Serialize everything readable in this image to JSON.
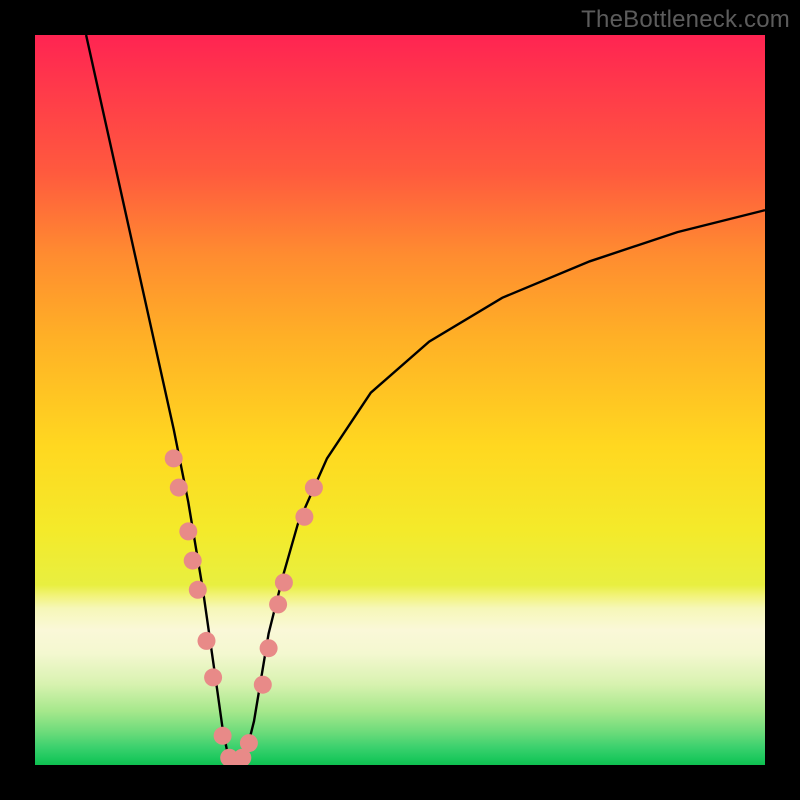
{
  "watermark": "TheBottleneck.com",
  "chart_data": {
    "type": "line",
    "title": "",
    "xlabel": "",
    "ylabel": "",
    "xlim": [
      0,
      100
    ],
    "ylim": [
      0,
      100
    ],
    "background": {
      "description": "vertical gradient red-to-green indicating bottleneck severity",
      "stops": [
        {
          "pos": 0,
          "color": "#ff2452"
        },
        {
          "pos": 55,
          "color": "#ffd820"
        },
        {
          "pos": 80,
          "color": "#f6f7b8"
        },
        {
          "pos": 100,
          "color": "#0ec050"
        }
      ]
    },
    "series": [
      {
        "name": "bottleneck-curve",
        "color": "#000000",
        "x": [
          7,
          9,
          11,
          13,
          15,
          17,
          19,
          21,
          22,
          23,
          24,
          25,
          25.7,
          26.3,
          27,
          28,
          29,
          30,
          31,
          32,
          34,
          36,
          40,
          46,
          54,
          64,
          76,
          88,
          100
        ],
        "y": [
          100,
          91,
          82,
          73,
          64,
          55,
          46,
          36,
          30,
          24,
          17,
          10,
          5,
          2,
          0,
          0,
          2,
          6,
          12,
          18,
          26,
          33,
          42,
          51,
          58,
          64,
          69,
          73,
          76
        ]
      }
    ],
    "markers": {
      "name": "highlighted-points",
      "color": "#e88a88",
      "radius_px": 9,
      "points": [
        {
          "x": 19.0,
          "y": 42
        },
        {
          "x": 19.7,
          "y": 38
        },
        {
          "x": 21.0,
          "y": 32
        },
        {
          "x": 21.6,
          "y": 28
        },
        {
          "x": 22.3,
          "y": 24
        },
        {
          "x": 23.5,
          "y": 17
        },
        {
          "x": 24.4,
          "y": 12
        },
        {
          "x": 25.7,
          "y": 4
        },
        {
          "x": 26.6,
          "y": 1
        },
        {
          "x": 27.5,
          "y": 0.5
        },
        {
          "x": 28.4,
          "y": 1
        },
        {
          "x": 29.3,
          "y": 3
        },
        {
          "x": 31.2,
          "y": 11
        },
        {
          "x": 32.0,
          "y": 16
        },
        {
          "x": 33.3,
          "y": 22
        },
        {
          "x": 34.1,
          "y": 25
        },
        {
          "x": 36.9,
          "y": 34
        },
        {
          "x": 38.2,
          "y": 38
        }
      ]
    }
  }
}
